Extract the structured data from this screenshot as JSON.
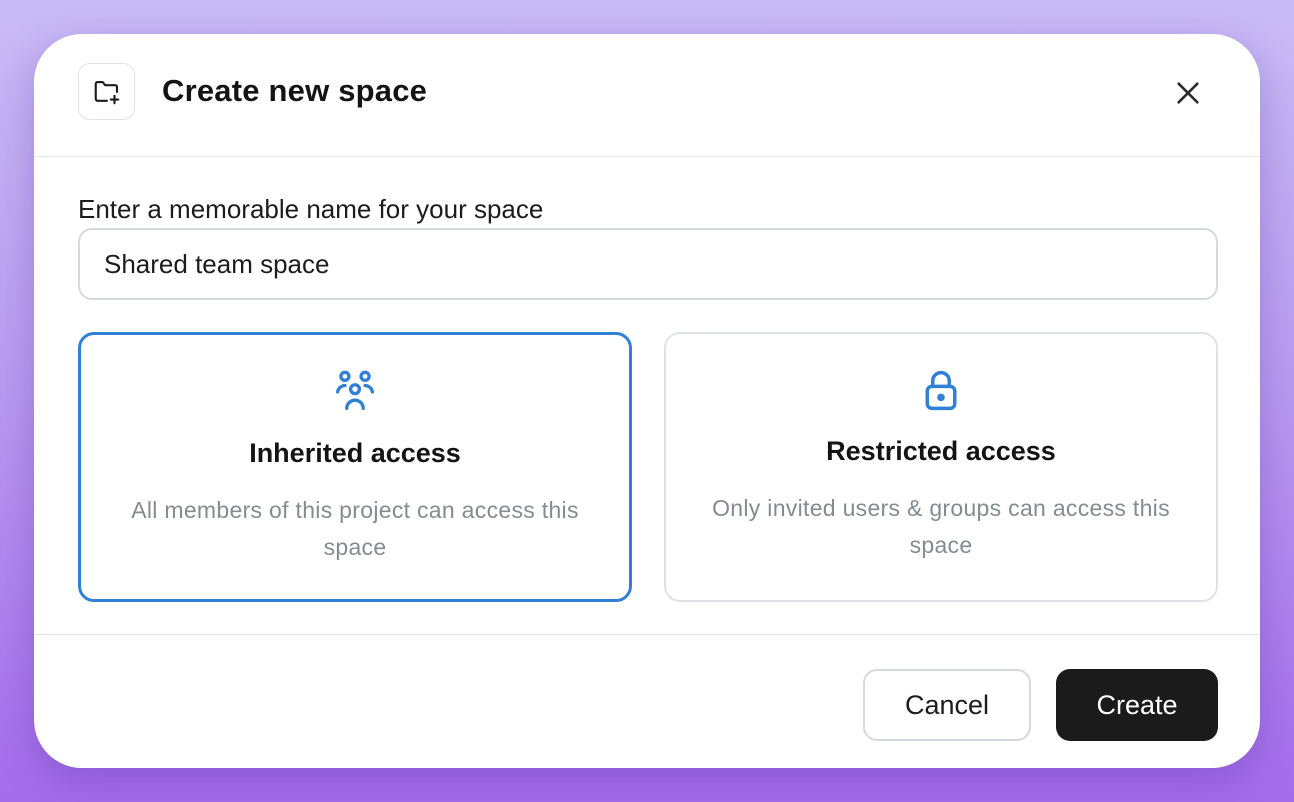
{
  "dialog": {
    "title": "Create new space",
    "header_icon": "folder-plus-icon",
    "close_icon": "close-icon"
  },
  "name_field": {
    "label": "Enter a memorable name for your space",
    "value": "Shared team space"
  },
  "access_options": [
    {
      "icon": "users-icon",
      "title": "Inherited access",
      "description": "All members of this project can access this space",
      "selected": true
    },
    {
      "icon": "lock-icon",
      "title": "Restricted access",
      "description": "Only invited users & groups can access this space",
      "selected": false
    }
  ],
  "footer": {
    "cancel_label": "Cancel",
    "create_label": "Create"
  },
  "colors": {
    "accent": "#2f80d6",
    "primary_button": "#1b1b1c",
    "muted_text": "#868b92"
  }
}
